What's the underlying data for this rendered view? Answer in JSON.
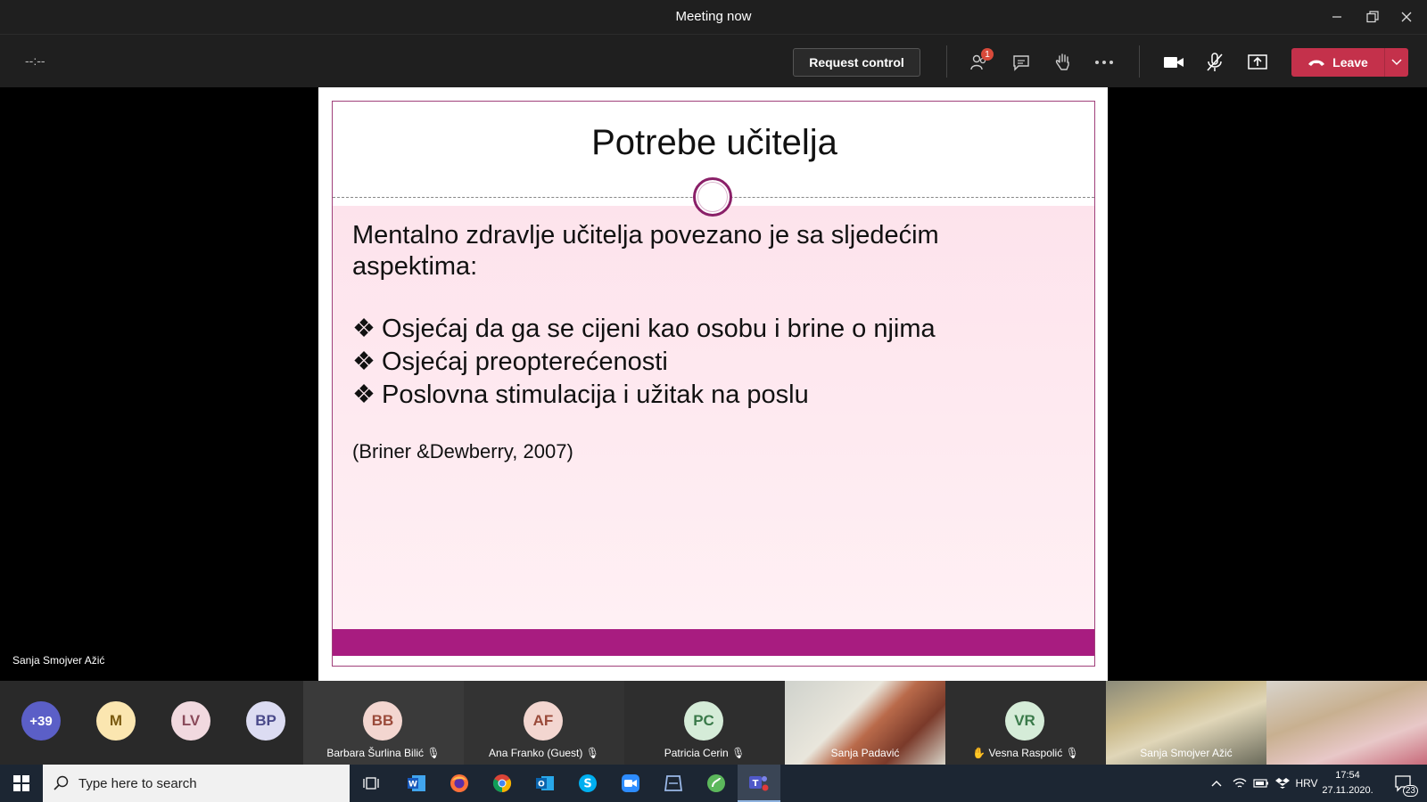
{
  "window": {
    "title": "Meeting now"
  },
  "toolbar": {
    "timer": "--:--",
    "request_control": "Request control",
    "participants_badge": "1",
    "leave_label": "Leave"
  },
  "slide": {
    "title": "Potrebe učitelja",
    "intro": "Mentalno zdravlje učitelja povezano je sa sljedećim aspektima:",
    "bullet_mark": "❖",
    "bullets": [
      "Osjećaj da ga se cijeni kao  osobu i brine o njima",
      "Osjećaj preopterećenosti",
      "Poslovna stimulacija i užitak na poslu"
    ],
    "citation": "(Briner &Dewberry, 2007)",
    "accent_color": "#a81c80"
  },
  "presenter": {
    "name": "Sanja Smojver Ažić"
  },
  "participants": {
    "overflow": "+39",
    "avatars": [
      "M",
      "LV",
      "BP"
    ],
    "tiles": [
      {
        "initials": "BB",
        "name": "Barbara Šurlina Bilić"
      },
      {
        "initials": "AF",
        "name": "Ana Franko (Guest)"
      },
      {
        "initials": "PC",
        "name": "Patricia Cerin"
      },
      {
        "initials": "",
        "name": "Sanja Padavić"
      },
      {
        "initials": "VR",
        "name": "Vesna Raspolić"
      },
      {
        "initials": "",
        "name": "Sanja Smojver Ažić"
      }
    ]
  },
  "taskbar": {
    "search_placeholder": "Type here to search",
    "language": "HRV",
    "time": "17:54",
    "date": "27.11.2020.",
    "notifications": "23"
  }
}
